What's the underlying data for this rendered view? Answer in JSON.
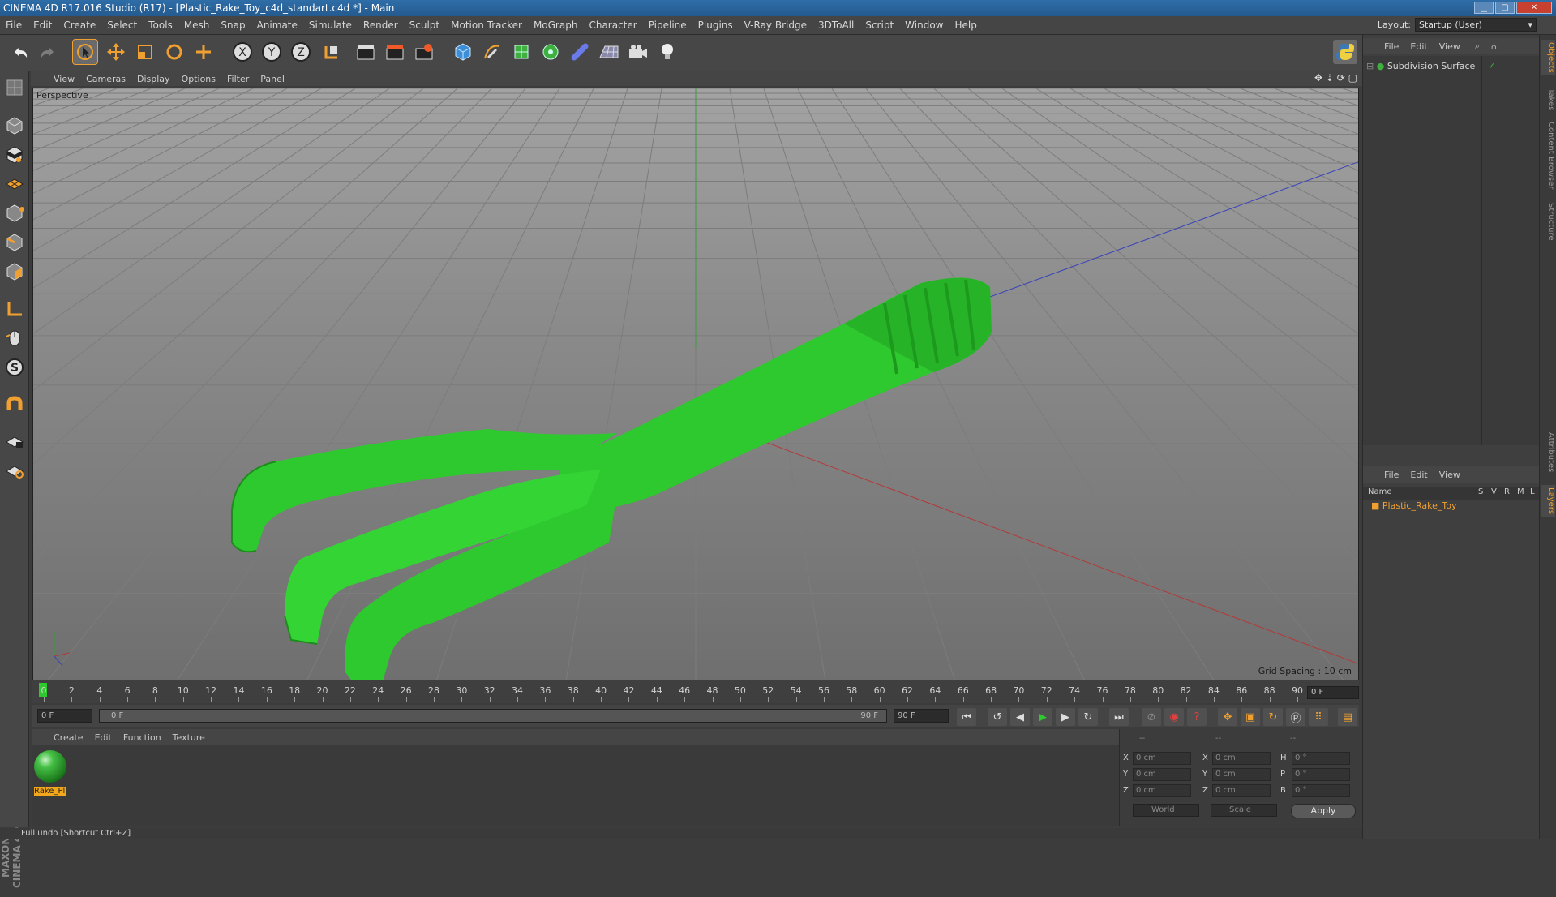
{
  "window": {
    "title": "CINEMA 4D R17.016 Studio (R17) - [Plastic_Rake_Toy_c4d_standart.c4d *] - Main"
  },
  "menu": [
    "File",
    "Edit",
    "Create",
    "Select",
    "Tools",
    "Mesh",
    "Snap",
    "Animate",
    "Simulate",
    "Render",
    "Sculpt",
    "Motion Tracker",
    "MoGraph",
    "Character",
    "Pipeline",
    "Plugins",
    "V-Ray Bridge",
    "3DToAll",
    "Script",
    "Window",
    "Help"
  ],
  "layout": {
    "label": "Layout:",
    "value": "Startup (User)"
  },
  "viewport": {
    "menu": [
      "View",
      "Cameras",
      "Display",
      "Options",
      "Filter",
      "Panel"
    ],
    "camera": "Perspective",
    "grid_spacing": "Grid Spacing : 10 cm",
    "model_color": "#2ec92e"
  },
  "timeline": {
    "ticks": [
      "0",
      "2",
      "4",
      "6",
      "8",
      "10",
      "12",
      "14",
      "16",
      "18",
      "20",
      "22",
      "24",
      "26",
      "28",
      "30",
      "32",
      "34",
      "36",
      "38",
      "40",
      "42",
      "44",
      "46",
      "48",
      "50",
      "52",
      "54",
      "56",
      "58",
      "60",
      "62",
      "64",
      "66",
      "68",
      "70",
      "72",
      "74",
      "76",
      "78",
      "80",
      "82",
      "84",
      "86",
      "88",
      "90"
    ],
    "current_frame": "0 F",
    "start": "0 F",
    "range_start": "0 F",
    "range_end": "90 F",
    "end": "90 F"
  },
  "material_manager": {
    "menu": [
      "Create",
      "Edit",
      "Function",
      "Texture"
    ],
    "material_label": "Rake_Pl"
  },
  "coordinates": {
    "headers": [
      "--",
      "--",
      "--"
    ],
    "rows": [
      {
        "a": "X",
        "av": "0 cm",
        "b": "X",
        "bv": "0 cm",
        "c": "H",
        "cv": "0 °"
      },
      {
        "a": "Y",
        "av": "0 cm",
        "b": "Y",
        "bv": "0 cm",
        "c": "P",
        "cv": "0 °"
      },
      {
        "a": "Z",
        "av": "0 cm",
        "b": "Z",
        "bv": "0 cm",
        "c": "B",
        "cv": "0 °"
      }
    ],
    "mode1": "World",
    "mode2": "Scale",
    "apply": "Apply"
  },
  "status": "Full undo [Shortcut Ctrl+Z]",
  "objects": {
    "menu": [
      "File",
      "Edit",
      "View"
    ],
    "item": "Subdivision Surface"
  },
  "layers": {
    "menu": [
      "File",
      "Edit",
      "View"
    ],
    "columns": [
      "Name",
      "S",
      "V",
      "R",
      "M",
      "L"
    ],
    "item": "Plastic_Rake_Toy"
  },
  "side_tabs": [
    "Objects",
    "Takes",
    "Content Browser",
    "Structure",
    "Attributes",
    "Layers"
  ],
  "brand": "MAXON CINEMA 4D"
}
